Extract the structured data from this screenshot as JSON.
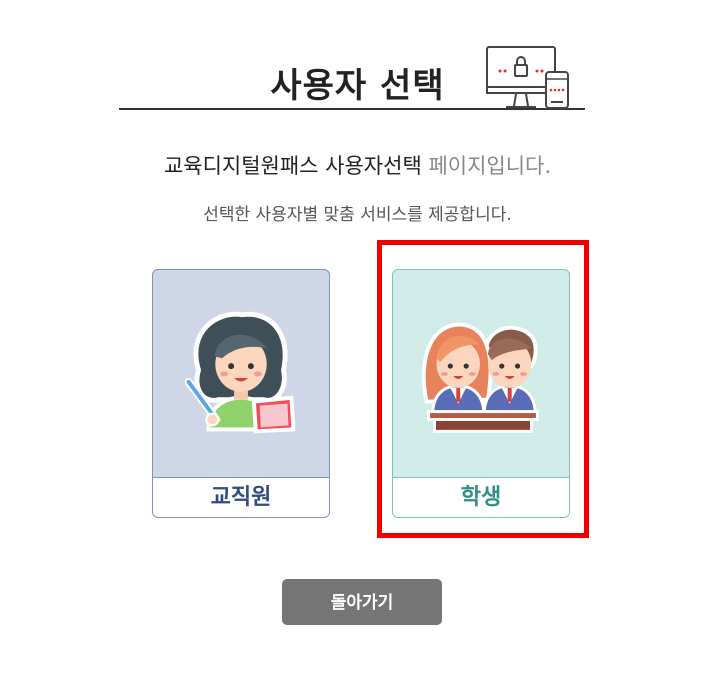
{
  "page": {
    "title": "사용자 선택",
    "lead_main": "교육디지털원패스 사용자선택 ",
    "lead_muted": "페이지입니다.",
    "subtitle": "선택한 사용자별 맞춤 서비스를 제공합니다."
  },
  "cards": {
    "staff": {
      "label": "교직원",
      "icon": "teacher-icon"
    },
    "student": {
      "label": "학생",
      "icon": "students-icon",
      "selected": true
    }
  },
  "actions": {
    "back_label": "돌아가기"
  },
  "colors": {
    "staff_bg": "#cfd6e8",
    "staff_text": "#2e4b86",
    "student_bg": "#d0ebe8",
    "student_text": "#2f8f86",
    "highlight": "#ee0000",
    "back_button": "#757575"
  }
}
